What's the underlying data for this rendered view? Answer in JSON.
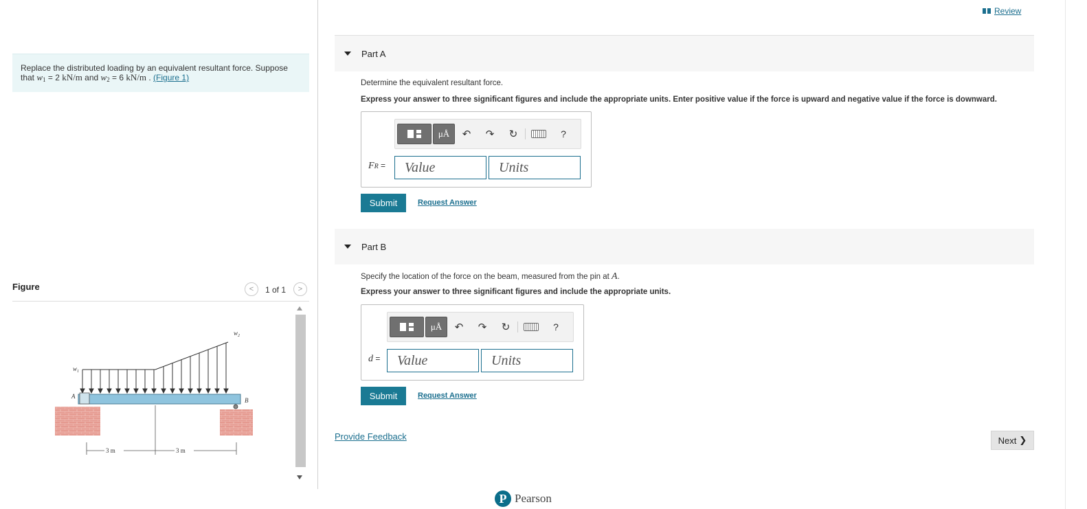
{
  "problem": {
    "text_1": "Replace the distributed loading by an equivalent resultant force. Suppose",
    "text_2": "that ",
    "w1_sym": "w",
    "w1_sub": "1",
    "w1_val": " = 2 ",
    "unit": "kN/m",
    "and": " and ",
    "w2_sym": "w",
    "w2_sub": "2",
    "w2_val": " = 6 ",
    "dot": " . ",
    "figure_link": "(Figure 1)"
  },
  "figure": {
    "title": "Figure",
    "pager": "1 of 1",
    "prev": "<",
    "next": ">",
    "labels": {
      "w1": "w",
      "w1_sub": "1",
      "w2": "w",
      "w2_sub": "2",
      "A": "A",
      "B": "B",
      "dim_left": "3 m",
      "dim_right": "3 m"
    }
  },
  "review": "Review",
  "part_a": {
    "title": "Part A",
    "question": "Determine the equivalent resultant force.",
    "instruction": "Express your answer to three significant figures and include the appropriate units. Enter positive value if the force is upward and negative value if the force is downward.",
    "var": "F",
    "var_sub": "R",
    "eq": " =",
    "value_placeholder": "Value",
    "units_placeholder": "Units",
    "submit": "Submit",
    "request": "Request Answer"
  },
  "part_b": {
    "title": "Part B",
    "question": "Specify the location of the force on the beam, measured from the pin at ",
    "point": "A",
    "period": ".",
    "instruction": "Express your answer to three significant figures and include the appropriate units.",
    "var": "d",
    "eq": " =",
    "value_placeholder": "Value",
    "units_placeholder": "Units",
    "submit": "Submit",
    "request": "Request Answer"
  },
  "toolbar": {
    "mu": "μÅ",
    "undo": "↶",
    "redo": "↷",
    "reset": "↻",
    "help": "?"
  },
  "feedback": "Provide Feedback",
  "next": "Next",
  "next_chevron": "❯",
  "brand": {
    "logo": "P",
    "name": "Pearson"
  },
  "colors": {
    "accent": "#1a7a94",
    "link": "#1a6e8e",
    "problem_bg": "#eaf6f7",
    "beam": "#8fc4de",
    "wall": "#e08a80"
  }
}
